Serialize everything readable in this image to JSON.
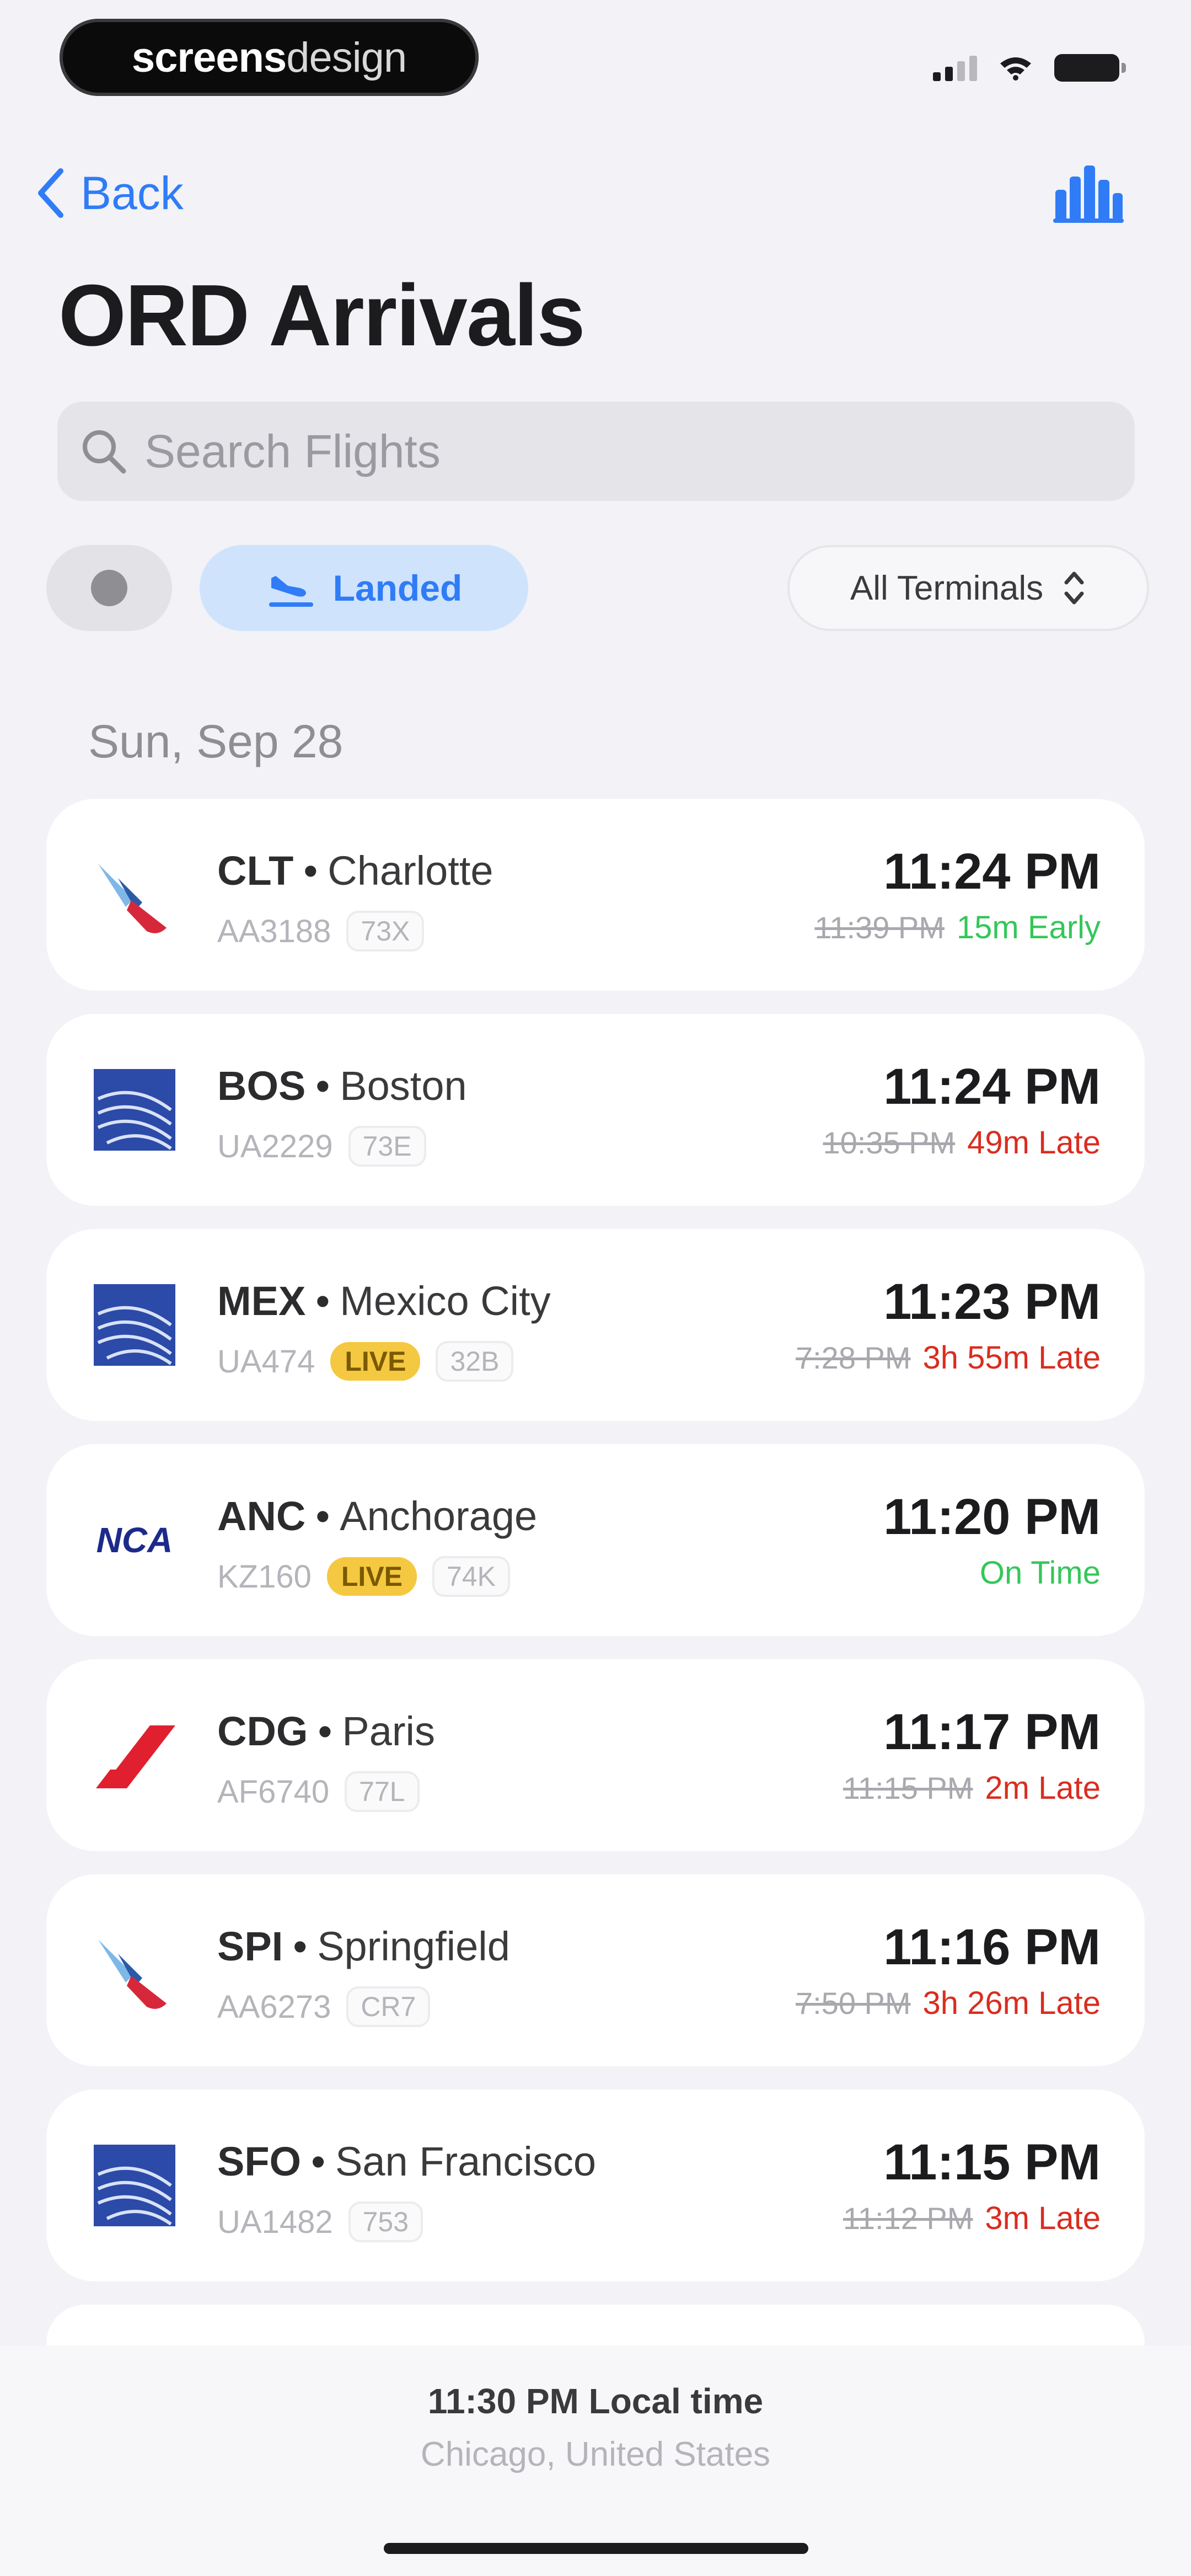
{
  "status_bar": {
    "watermark_bold": "screens",
    "watermark_thin": "design"
  },
  "nav": {
    "back_label": "Back",
    "title": "ORD Arrivals"
  },
  "search": {
    "placeholder": "Search Flights",
    "value": ""
  },
  "filters": {
    "landed_label": "Landed",
    "terminal_label": "All Terminals"
  },
  "date_header": "Sun, Sep 28",
  "colors": {
    "accent": "#2f7cf6",
    "early": "#34c759",
    "late": "#d92d20",
    "live": "#f5c842"
  },
  "flights": [
    {
      "airline_icon": "american-airlines-logo",
      "code": "CLT",
      "city": "Charlotte",
      "flight_no": "AA3188",
      "live": "",
      "aircraft": "73X",
      "time": "11:24 PM",
      "scheduled": "11:39 PM",
      "status": "15m Early",
      "status_type": "early"
    },
    {
      "airline_icon": "united-airlines-logo",
      "code": "BOS",
      "city": "Boston",
      "flight_no": "UA2229",
      "live": "",
      "aircraft": "73E",
      "time": "11:24 PM",
      "scheduled": "10:35 PM",
      "status": "49m Late",
      "status_type": "late"
    },
    {
      "airline_icon": "united-airlines-logo",
      "code": "MEX",
      "city": "Mexico City",
      "flight_no": "UA474",
      "live": "LIVE",
      "aircraft": "32B",
      "time": "11:23 PM",
      "scheduled": "7:28 PM",
      "status": "3h 55m Late",
      "status_type": "late"
    },
    {
      "airline_icon": "nca-logo",
      "code": "ANC",
      "city": "Anchorage",
      "flight_no": "KZ160",
      "live": "LIVE",
      "aircraft": "74K",
      "time": "11:20 PM",
      "scheduled": "",
      "status": "On Time",
      "status_type": "ontime"
    },
    {
      "airline_icon": "air-france-logo",
      "code": "CDG",
      "city": "Paris",
      "flight_no": "AF6740",
      "live": "",
      "aircraft": "77L",
      "time": "11:17 PM",
      "scheduled": "11:15 PM",
      "status": "2m Late",
      "status_type": "late"
    },
    {
      "airline_icon": "american-airlines-logo",
      "code": "SPI",
      "city": "Springfield",
      "flight_no": "AA6273",
      "live": "",
      "aircraft": "CR7",
      "time": "11:16 PM",
      "scheduled": "7:50 PM",
      "status": "3h 26m Late",
      "status_type": "late"
    },
    {
      "airline_icon": "united-airlines-logo",
      "code": "SFO",
      "city": "San Francisco",
      "flight_no": "UA1482",
      "live": "",
      "aircraft": "753",
      "time": "11:15 PM",
      "scheduled": "11:12 PM",
      "status": "3m Late",
      "status_type": "late"
    }
  ],
  "footer": {
    "local_time": "11:30 PM Local time",
    "location": "Chicago, United States"
  }
}
